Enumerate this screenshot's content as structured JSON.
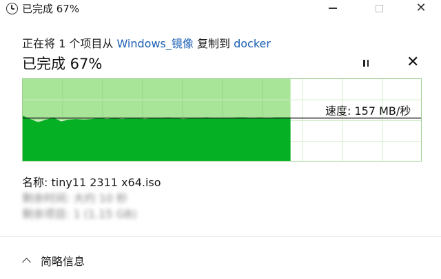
{
  "window": {
    "title": "已完成 67%",
    "minimize_icon": "minimize-icon",
    "maximize_icon": "maximize-icon",
    "close_label": "✕"
  },
  "header": {
    "prefix": "正在将 1 个项目从 ",
    "source": "Windows_镜像",
    "middle": " 复制到 ",
    "destination": "docker"
  },
  "progress": {
    "title": "已完成 67%",
    "percent": 67,
    "pause_icon": "pause-icon",
    "cancel_label": "✕"
  },
  "graph": {
    "speed_label": "速度: 157 MB/秒",
    "colors": {
      "done_bg": "#a8e598",
      "fill": "#06b025",
      "grid": "#d2ecca",
      "line": "#222222"
    },
    "speed_series_rel": [
      0.44,
      0.48,
      0.52,
      0.49,
      0.46,
      0.51,
      0.49,
      0.48,
      0.49,
      0.48,
      0.47,
      0.48,
      0.47,
      0.48,
      0.47,
      0.47,
      0.48,
      0.47,
      0.47,
      0.46,
      0.47,
      0.48,
      0.47,
      0.47,
      0.46,
      0.47,
      0.47,
      0.47,
      0.46,
      0.46,
      0.47,
      0.46,
      0.47,
      0.46,
      0.46,
      0.46
    ],
    "current_speed_rel": 0.47
  },
  "details": {
    "name_line": "名称: tiny11 2311 x64.iso",
    "remaining_line": "剩余时间: 大约 10 秒",
    "items_line": "剩余项目: 1 (1.15 GB)"
  },
  "footer": {
    "toggle_label": "简略信息",
    "chevron_icon": "chevron-up-icon"
  }
}
